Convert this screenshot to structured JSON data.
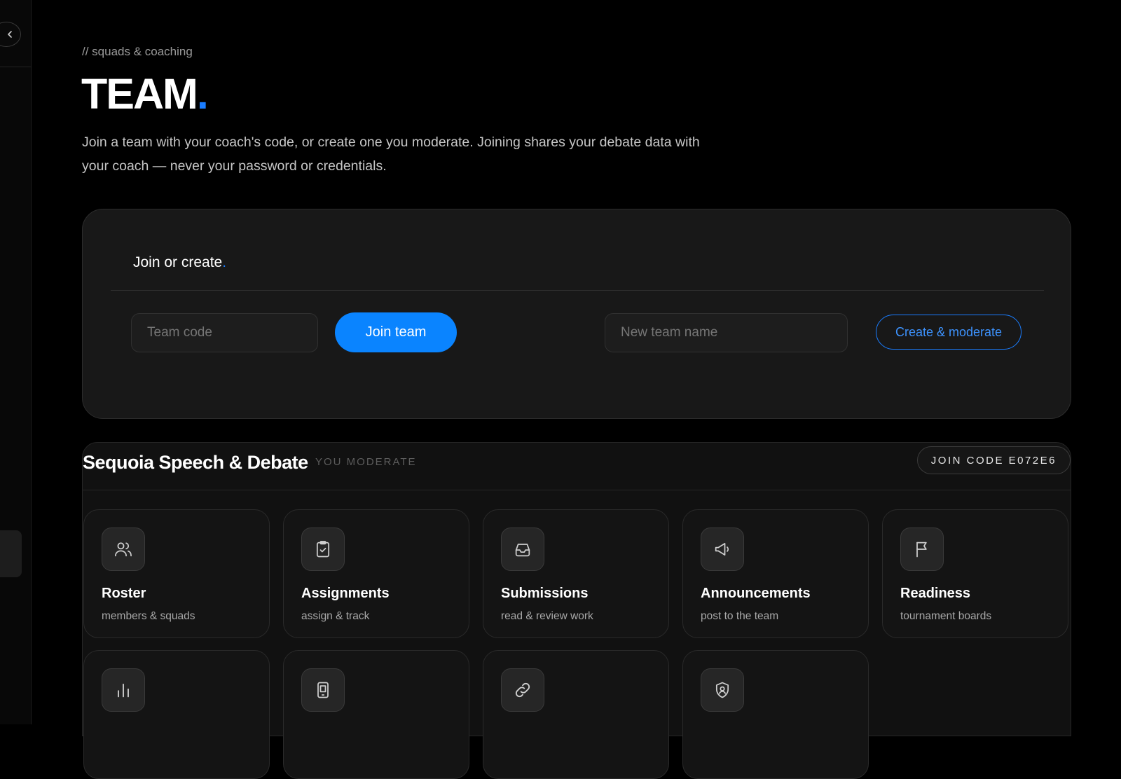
{
  "sidebar": {
    "collapse_icon": "chevron-left-icon"
  },
  "header": {
    "eyebrow": "// squads & coaching",
    "title": "TEAM",
    "title_dot": ".",
    "intro": "Join a team with your coach's code, or create one you moderate. Joining shares your debate data with your coach — never your password or credentials."
  },
  "join_card": {
    "heading": "Join or create",
    "heading_dot": ".",
    "team_code_placeholder": "Team code",
    "join_button": "Join team",
    "new_team_placeholder": "New team name",
    "create_button": "Create & moderate"
  },
  "team": {
    "name": "Sequoia Speech & Debate",
    "role": "YOU MODERATE",
    "join_code": "JOIN CODE E072E6",
    "tiles": [
      {
        "title": "Roster",
        "subtitle": "members & squads",
        "icon": "users-icon"
      },
      {
        "title": "Assignments",
        "subtitle": "assign & track",
        "icon": "clipboard-check-icon"
      },
      {
        "title": "Submissions",
        "subtitle": "read & review work",
        "icon": "inbox-icon"
      },
      {
        "title": "Announcements",
        "subtitle": "post to the team",
        "icon": "megaphone-icon"
      },
      {
        "title": "Readiness",
        "subtitle": "tournament boards",
        "icon": "flag-icon"
      },
      {
        "title": "",
        "subtitle": "",
        "icon": "bar-chart-icon"
      },
      {
        "title": "",
        "subtitle": "",
        "icon": "tablet-icon"
      },
      {
        "title": "",
        "subtitle": "",
        "icon": "link-icon"
      },
      {
        "title": "",
        "subtitle": "",
        "icon": "shield-user-icon"
      }
    ]
  },
  "colors": {
    "accent": "#0a84ff",
    "background": "#000000",
    "card": "#181818"
  }
}
